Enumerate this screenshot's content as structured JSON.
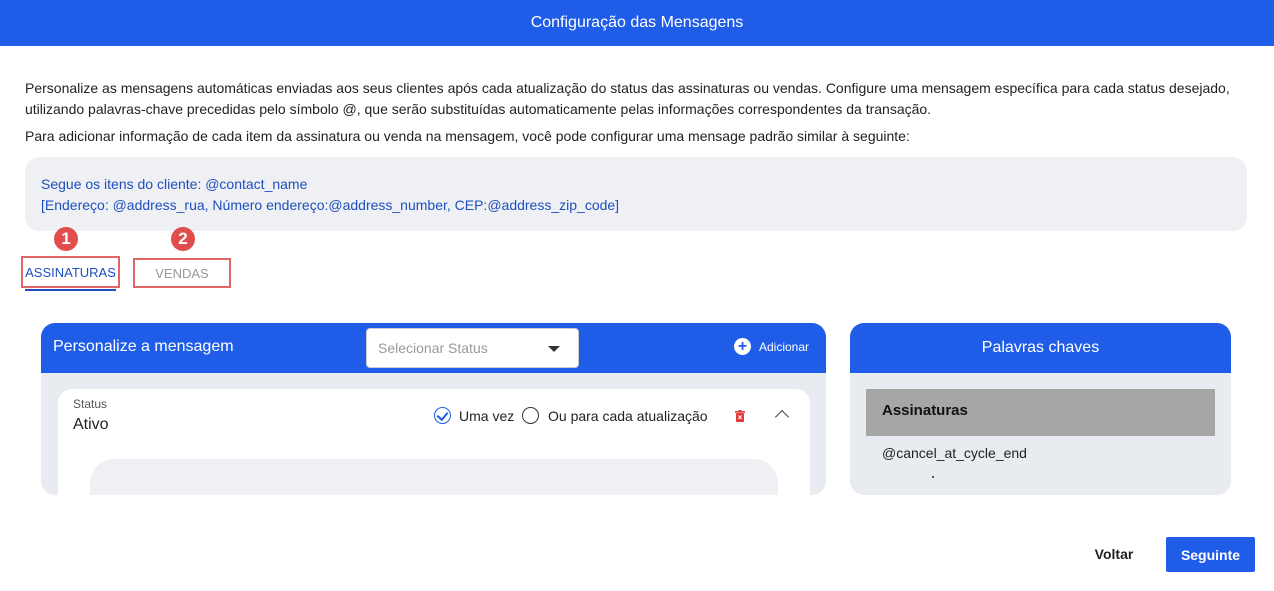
{
  "header": {
    "title": "Configuração das Mensagens"
  },
  "intro": {
    "paragraph1": "Personalize as mensagens automáticas enviadas aos seus clientes após cada atualização do status das assinaturas ou vendas. Configure uma mensagem específica para cada status desejado, utilizando palavras-chave precedidas pelo símbolo @, que serão substituídas automaticamente pelas informações correspondentes da transação.",
    "paragraph2": "Para adicionar informação de cada item da assinatura ou venda na mensagem, você pode configurar uma mensage padrão similar à seguinte:"
  },
  "example": {
    "line1": "Segue os itens do cliente: @contact_name",
    "line2": "[Endereço: @address_rua, Número endereço:@address_number, CEP:@address_zip_code]"
  },
  "annotations": {
    "badge1": "1",
    "badge2": "2",
    "color": "#e14d4d"
  },
  "tabs": [
    {
      "label": "ASSINATURAS",
      "active": true
    },
    {
      "label": "VENDAS",
      "active": false
    }
  ],
  "message_panel": {
    "title": "Personalize a mensagem",
    "select_placeholder": "Selecionar Status",
    "add_label": "Adicionar",
    "card": {
      "status_label": "Status",
      "status_value": "Ativo",
      "option_once": "Uma vez",
      "option_each": "Ou para cada atualização",
      "option_once_checked": true
    }
  },
  "keywords_panel": {
    "title": "Palavras chaves",
    "section": "Assinaturas",
    "items": [
      "@cancel_at_cycle_end"
    ]
  },
  "footer": {
    "back_label": "Voltar",
    "next_label": "Seguinte"
  },
  "colors": {
    "primary": "#1f5ce8",
    "danger": "#e53935",
    "annotation": "#e06666"
  }
}
